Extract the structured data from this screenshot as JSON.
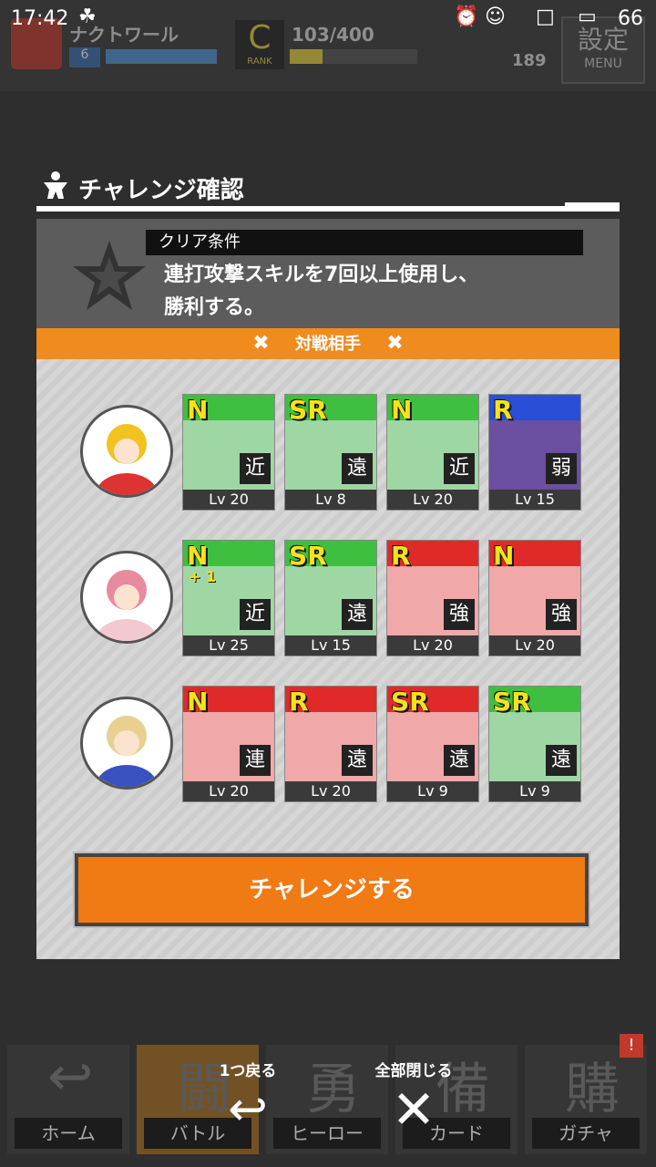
{
  "statusbar": {
    "time": "17:42",
    "battery": "66"
  },
  "header": {
    "player_name": "ナクトワール",
    "level": "6",
    "rank_letter": "C",
    "rank_caption": "RANK",
    "stamina": "103/400",
    "coins": "189",
    "menu_top": "設定",
    "menu_bottom": "MENU"
  },
  "dialog": {
    "title": "チャレンジ確認",
    "condition_label": "クリア条件",
    "condition_line1": "連打攻撃スキルを7回以上使用し、",
    "condition_line2": "勝利する。",
    "opponent_header": "対戦相手",
    "x_mark": "✖"
  },
  "opponents": [
    {
      "cards": [
        {
          "rarity": "N",
          "type": "近",
          "level": "Lv 20",
          "band": "green",
          "plus": ""
        },
        {
          "rarity": "SR",
          "type": "遠",
          "level": "Lv 8",
          "band": "green",
          "plus": ""
        },
        {
          "rarity": "N",
          "type": "近",
          "level": "Lv 20",
          "band": "green",
          "plus": ""
        },
        {
          "rarity": "R",
          "type": "弱",
          "level": "Lv 15",
          "band": "blue",
          "plus": ""
        }
      ]
    },
    {
      "cards": [
        {
          "rarity": "N",
          "type": "近",
          "level": "Lv 25",
          "band": "green",
          "plus": "+ 1"
        },
        {
          "rarity": "SR",
          "type": "遠",
          "level": "Lv 15",
          "band": "green",
          "plus": ""
        },
        {
          "rarity": "R",
          "type": "強",
          "level": "Lv 20",
          "band": "red",
          "plus": ""
        },
        {
          "rarity": "N",
          "type": "強",
          "level": "Lv 20",
          "band": "red",
          "plus": ""
        }
      ]
    },
    {
      "cards": [
        {
          "rarity": "N",
          "type": "連",
          "level": "Lv 20",
          "band": "red",
          "plus": ""
        },
        {
          "rarity": "R",
          "type": "遠",
          "level": "Lv 20",
          "band": "red",
          "plus": ""
        },
        {
          "rarity": "SR",
          "type": "遠",
          "level": "Lv 9",
          "band": "red",
          "plus": ""
        },
        {
          "rarity": "SR",
          "type": "遠",
          "level": "Lv 9",
          "band": "green",
          "plus": ""
        }
      ]
    }
  ],
  "challenge_button": "チャレンジする",
  "nav": {
    "tabs": [
      {
        "label": "ホーム",
        "icon_text": "↩"
      },
      {
        "label": "バトル",
        "icon_text": "闘"
      },
      {
        "label": "ヒーロー",
        "icon_text": "勇"
      },
      {
        "label": "カード",
        "icon_text": "備"
      },
      {
        "label": "ガチャ",
        "icon_text": "購"
      }
    ],
    "back_caption": "1つ戻る",
    "back_icon": "↩",
    "close_caption": "全部閉じる",
    "close_icon": "✕",
    "gacha_badge": "!"
  },
  "colors": {
    "accent": "#f08c1e",
    "band_green": "#3fbf3f",
    "band_red": "#e02a2a",
    "band_blue": "#2a4fd6"
  }
}
